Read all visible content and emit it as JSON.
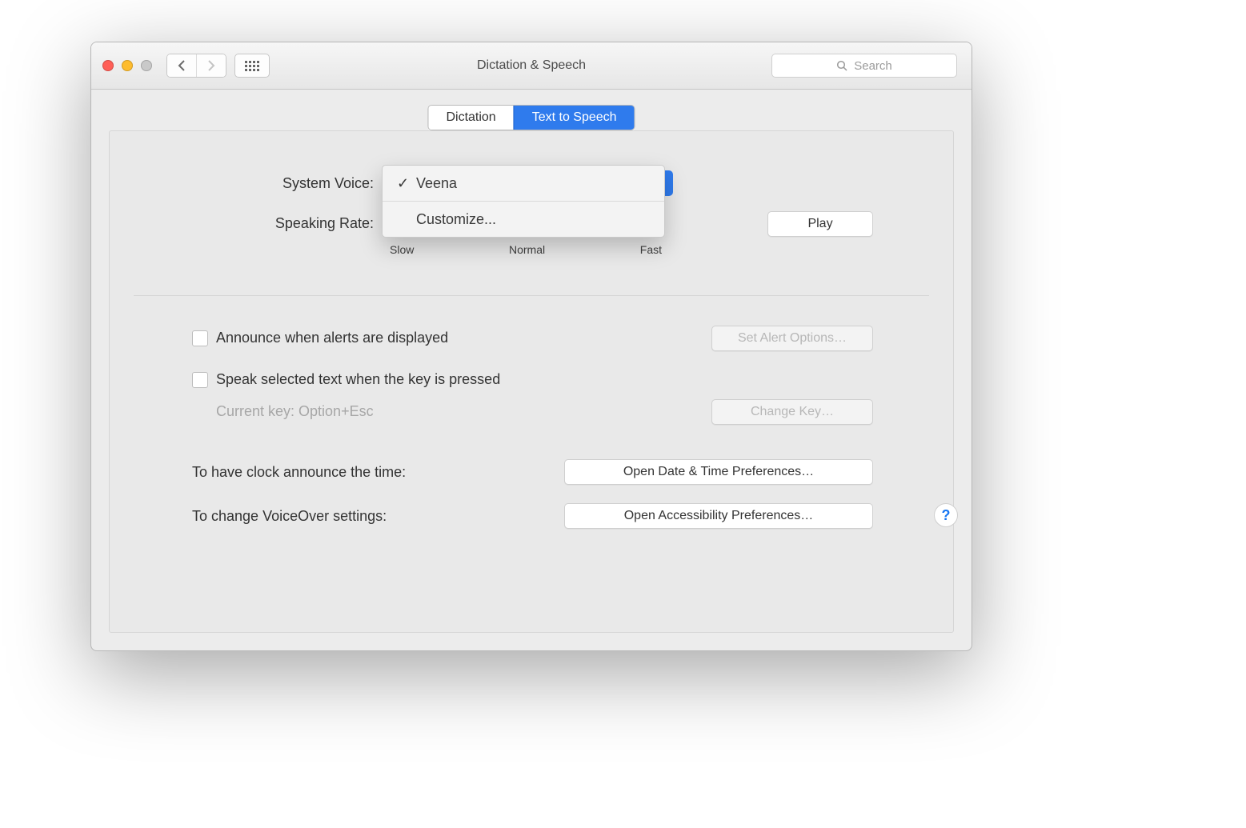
{
  "window": {
    "title": "Dictation & Speech",
    "search_placeholder": "Search"
  },
  "tabs": {
    "dictation": "Dictation",
    "tts": "Text to Speech"
  },
  "voice": {
    "label": "System Voice:",
    "menu": {
      "selected": "Veena",
      "customize": "Customize..."
    }
  },
  "rate": {
    "label": "Speaking Rate:",
    "ticks": {
      "slow": "Slow",
      "normal": "Normal",
      "fast": "Fast"
    },
    "play": "Play"
  },
  "options": {
    "announce_alerts": "Announce when alerts are displayed",
    "set_alert": "Set Alert Options…",
    "speak_selected": "Speak selected text when the key is pressed",
    "current_key": "Current key: Option+Esc",
    "change_key": "Change Key…"
  },
  "links": {
    "clock_label": "To have clock announce the time:",
    "open_datetime": "Open Date & Time Preferences…",
    "vo_label": "To change VoiceOver settings:",
    "open_accessibility": "Open Accessibility Preferences…"
  },
  "help": "?"
}
